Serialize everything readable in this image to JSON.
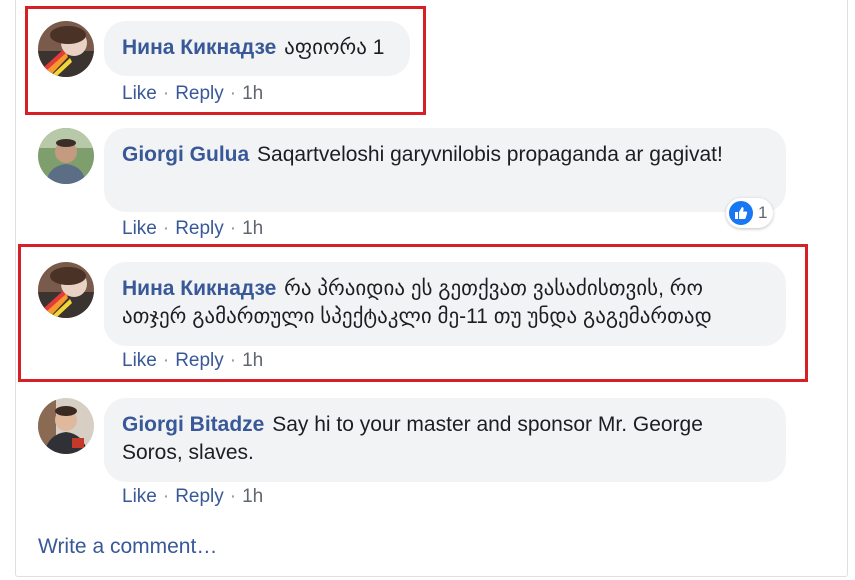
{
  "comments": [
    {
      "author": "Нина Кикнадзе",
      "text": "აფიორა 1",
      "actions": {
        "like": "Like",
        "reply": "Reply",
        "sep": "·",
        "time": "1h"
      }
    },
    {
      "author": "Giorgi Gulua",
      "text": "Saqartveloshi garyvnilobis propaganda ar gagivat!",
      "actions": {
        "like": "Like",
        "reply": "Reply",
        "sep": "·",
        "time": "1h"
      },
      "reaction": {
        "icon": "like-icon",
        "count": "1"
      }
    },
    {
      "author": "Нина Кикнадзе",
      "text": "რა პრაიდია ეს გეთქვათ ვასაძისთვის, რო ათჯერ გამართული სპექტაკლი მე-11 თუ უნდა გაგემართად",
      "actions": {
        "like": "Like",
        "reply": "Reply",
        "sep": "·",
        "time": "1h"
      }
    },
    {
      "author": "Giorgi Bitadze",
      "text": "Say hi to your master and sponsor Mr. George Soros, slaves.",
      "actions": {
        "like": "Like",
        "reply": "Reply",
        "sep": "·",
        "time": "1h"
      }
    }
  ],
  "write_comment": {
    "placeholder": "Write a comment…"
  },
  "colors": {
    "link": "#385898",
    "bubble": "#f2f3f5",
    "highlight": "#d71f26",
    "like_blue": "#1877f2"
  }
}
